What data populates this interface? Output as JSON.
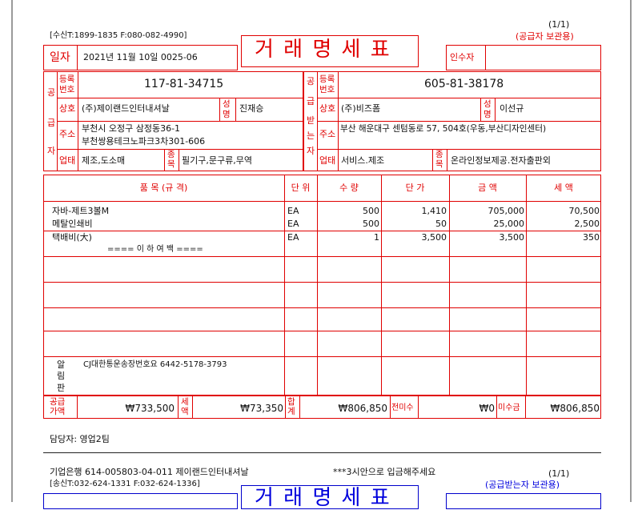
{
  "page_indicator": "(1/1)",
  "receiver_tel": "[수신T:1899-1835 F:080-082-4990]",
  "copy_label": "(공급자 보관용)",
  "title": "거 래 명 세 표",
  "date_label": "일자",
  "date_value": "2021년 11월 10일   0025-06",
  "receiver_sign_label": "인수자",
  "supplier": {
    "side_label": [
      "공",
      "급",
      "자"
    ],
    "reg_label": [
      "등록",
      "번호"
    ],
    "reg_no": "117-81-34715",
    "company_label": "상호",
    "company": "(주)제이랜드인터내셔날",
    "name_label": [
      "성",
      "명"
    ],
    "name": "진재승",
    "addr_label": "주소",
    "addr_line1": "부천시 오정구 삼정동36-1",
    "addr_line2": "부천쌍용테크노파크3차301-606",
    "biz_label": "업태",
    "biz": "제조,도소매",
    "item_label": [
      "종",
      "목"
    ],
    "item": "필기구,문구류,무역"
  },
  "buyer": {
    "side_label": [
      "공",
      "급",
      "받",
      "는",
      "자"
    ],
    "reg_label": [
      "등록",
      "번호"
    ],
    "reg_no": "605-81-38178",
    "company_label": "상호",
    "company": "(주)비즈폼",
    "name_label": [
      "성",
      "명"
    ],
    "name": "이선규",
    "addr_label": "주소",
    "addr": "부산 해운대구 센텀동로 57, 504호(우동,부산디자인센터)",
    "biz_label": "업태",
    "biz": "서비스.제조",
    "item_label": [
      "종",
      "목"
    ],
    "item": "온라인정보제공.전자출판외"
  },
  "table": {
    "headers": [
      "품 목 (규 격)",
      "단 위",
      "수 량",
      "단 가",
      "금 액",
      "세 액"
    ],
    "rows": [
      {
        "item": "자바-제트3볼M",
        "unit": "EA",
        "qty": "500",
        "price": "1,410",
        "amount": "705,000",
        "tax": "70,500"
      },
      {
        "item": "메탈인쇄비",
        "unit": "EA",
        "qty": "500",
        "price": "50",
        "amount": "25,000",
        "tax": "2,500"
      },
      {
        "item": "택배비(大)",
        "unit": "EA",
        "qty": "1",
        "price": "3,500",
        "amount": "3,500",
        "tax": "350"
      }
    ],
    "end_marker": "==== 이 하 여 백 ===="
  },
  "memo_label": [
    "알",
    "림",
    "판"
  ],
  "memo_text": "CJ대한통운송장번호요 6442-5178-3793",
  "totals": {
    "supply_label": [
      "공급",
      "가액"
    ],
    "supply": "₩733,500",
    "tax_label": [
      "세",
      "액"
    ],
    "tax": "₩73,350",
    "sum_label": [
      "합",
      "계"
    ],
    "sum": "₩806,850",
    "prev_unpaid_label": "전미수",
    "prev_unpaid": "₩0",
    "unpaid_label": "미수금",
    "unpaid": "₩806,850"
  },
  "manager": "담당자: 영업2팀",
  "bank_line": "기업은행 614-005803-04-011 제이랜드인터내셔날",
  "deposit_note": "***3시안으로 입금해주세요",
  "page_indicator2": "(1/1)",
  "sender_tel": "[송신T:032-624-1331 F:032-624-1336]",
  "copy_label2": "(공급받는자 보관용)",
  "title2": "거 래 명 세 표"
}
